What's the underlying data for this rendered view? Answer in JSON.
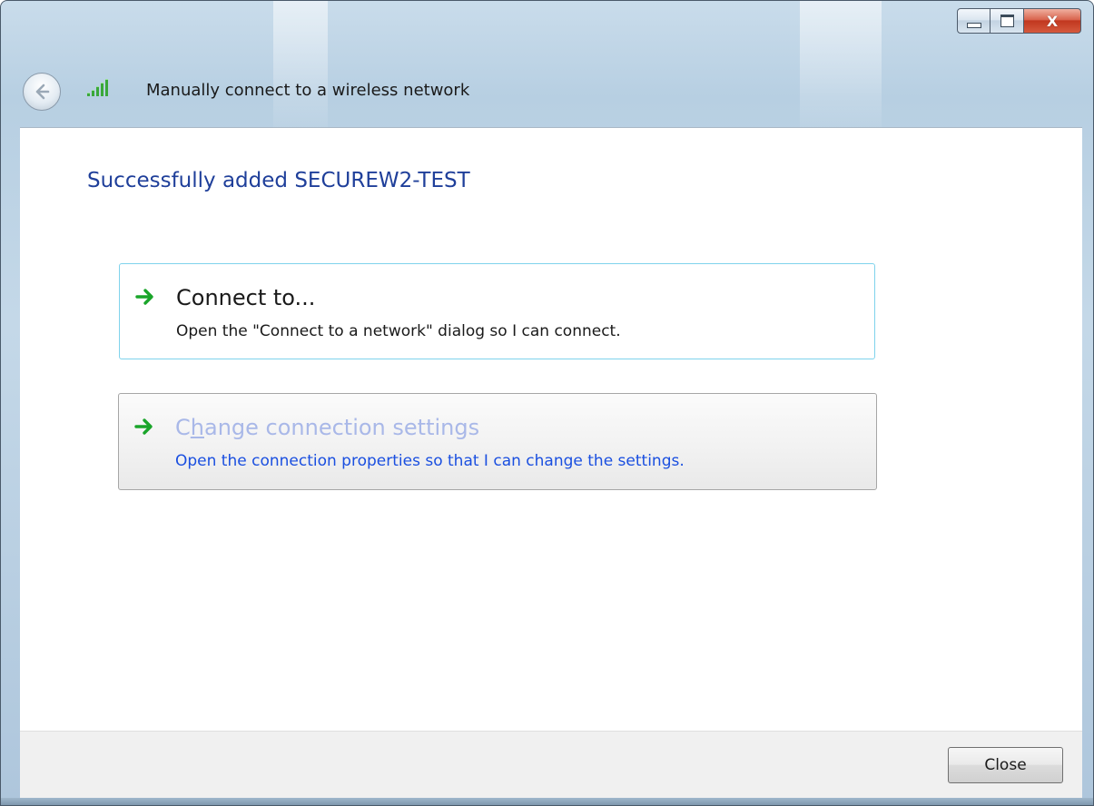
{
  "window": {
    "title": "Manually connect to a wireless network",
    "caption_buttons": {
      "minimize_icon": "minimize-icon",
      "maximize_icon": "maximize-icon",
      "close_glyph": "X"
    }
  },
  "header": {
    "back_icon": "back-arrow-icon",
    "network_icon": "wireless-signal-icon"
  },
  "main": {
    "heading": "Successfully added SECUREW2-TEST",
    "links": [
      {
        "title": "Connect to...",
        "description": "Open the \"Connect to a network\" dialog so I can connect.",
        "icon": "green-arrow-icon"
      },
      {
        "title_prefix": "C",
        "title_accel": "h",
        "title_suffix": "ange connection settings",
        "description": "Open the connection properties so that I can change the settings.",
        "icon": "green-arrow-icon"
      }
    ]
  },
  "footer": {
    "close_label": "Close"
  },
  "colors": {
    "heading": "#1f3f9a",
    "link_hover_border": "#7fd3ec",
    "disabled_title": "#a9b8e8",
    "link_desc_blue": "#1a4fe0",
    "arrow_green": "#1aa52a"
  }
}
